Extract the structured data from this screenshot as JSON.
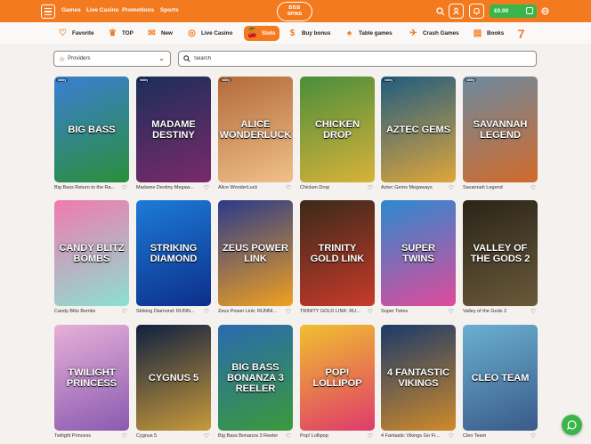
{
  "header": {
    "nav": [
      "Games",
      "Live Casino",
      "Promotions",
      "Sports"
    ],
    "logo": {
      "line1": "BBB",
      "line2": "SPINS"
    },
    "balance": "€0.00",
    "colors": {
      "brand": "#f37a1f",
      "wallet": "#39b54a"
    }
  },
  "categories": [
    {
      "label": "Favorite",
      "icon": "heart-icon"
    },
    {
      "label": "TOP",
      "icon": "crown-icon"
    },
    {
      "label": "New",
      "icon": "megaphone-icon"
    },
    {
      "label": "Live Casino",
      "icon": "roulette-icon"
    },
    {
      "label": "Slots",
      "icon": "cherries-icon",
      "active": true
    },
    {
      "label": "Buy bonus",
      "icon": "coin-icon"
    },
    {
      "label": "Table games",
      "icon": "cards-icon"
    },
    {
      "label": "Crash Games",
      "icon": "plane-icon"
    },
    {
      "label": "Books",
      "icon": "book-icon"
    },
    {
      "label": "",
      "icon": "seven-icon"
    }
  ],
  "filters": {
    "providers_label": "Providers",
    "search_placeholder": "Search"
  },
  "games": [
    {
      "caption": "Big Bass Return to the Ra...",
      "art": "BIG BASS",
      "badge": "lobby",
      "bg": [
        "#3b7ed3",
        "#2a8f3a"
      ]
    },
    {
      "caption": "Madame Destiny Megaw...",
      "art": "MADAME DESTINY",
      "badge": "lobby",
      "bg": [
        "#1b2e5a",
        "#7a2a6a"
      ]
    },
    {
      "caption": "Alice WonderLuck",
      "art": "ALICE WONDERLUCK",
      "badge": "lobby",
      "bg": [
        "#b36a3a",
        "#f0c08a"
      ]
    },
    {
      "caption": "Chicken Drop",
      "art": "CHICKEN DROP",
      "badge": "",
      "bg": [
        "#4a8e3a",
        "#d9b23a"
      ]
    },
    {
      "caption": "Aztec Gems Megaways",
      "art": "AZTEC GEMS",
      "badge": "lobby",
      "bg": [
        "#1f5c80",
        "#e0a63a"
      ]
    },
    {
      "caption": "Savannah Legend",
      "art": "SAVANNAH LEGEND",
      "badge": "lobby",
      "bg": [
        "#6c8aa0",
        "#d36a2a"
      ]
    },
    {
      "caption": "Candy Blitz Bombs",
      "art": "CANDY BLITZ BOMBS",
      "badge": "",
      "bg": [
        "#f07ab0",
        "#8be0d0"
      ]
    },
    {
      "caption": "Striking Diamond: RUNN...",
      "art": "STRIKING DIAMOND",
      "badge": "",
      "bg": [
        "#1d7bd8",
        "#0c2f8a"
      ]
    },
    {
      "caption": "Zeus Power Link: RUNNI...",
      "art": "ZEUS POWER LINK",
      "badge": "",
      "bg": [
        "#2a3a8a",
        "#f0a020"
      ]
    },
    {
      "caption": "TRINITY GOLD LINK: RU...",
      "art": "TRINITY GOLD LINK",
      "badge": "",
      "bg": [
        "#3a2a1a",
        "#c83a2a"
      ]
    },
    {
      "caption": "Super Twins",
      "art": "SUPER TWINS",
      "badge": "",
      "bg": [
        "#2a8ad0",
        "#e04a9a"
      ]
    },
    {
      "caption": "Valley of the Gods 2",
      "art": "VALLEY OF THE GODS 2",
      "badge": "",
      "bg": [
        "#2a2418",
        "#6a5a3a"
      ]
    },
    {
      "caption": "Twilight Princess",
      "art": "TWILIGHT PRINCESS",
      "badge": "",
      "bg": [
        "#e6b0d8",
        "#8a5ab0"
      ]
    },
    {
      "caption": "Cygnus 5",
      "art": "CYGNUS 5",
      "badge": "",
      "bg": [
        "#102040",
        "#c89a3a"
      ]
    },
    {
      "caption": "Big Bass Bonanza 3 Reeler",
      "art": "BIG BASS BONANZA 3 REELER",
      "badge": "",
      "bg": [
        "#2a6ab0",
        "#3a9a3a"
      ]
    },
    {
      "caption": "Pop! Lollipop",
      "art": "POP! LOLLIPOP",
      "badge": "",
      "bg": [
        "#f0c030",
        "#e03a6a"
      ]
    },
    {
      "caption": "4 Fantastic Vikings Go Fi...",
      "art": "4 FANTASTIC VIKINGS",
      "badge": "",
      "bg": [
        "#1a3a6a",
        "#d08a2a"
      ]
    },
    {
      "caption": "Cleo Team",
      "art": "CLEO TEAM",
      "badge": "",
      "bg": [
        "#6ab0d0",
        "#3a5a8a"
      ]
    }
  ]
}
